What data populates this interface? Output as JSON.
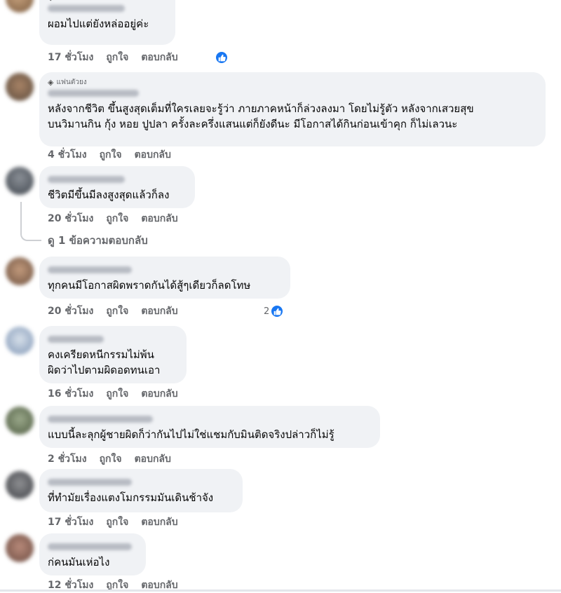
{
  "badge_text": "แฟนตัวยง",
  "actions": {
    "like": "ถูกใจ",
    "reply": "ตอบกลับ"
  },
  "view_replies": "ดู 1 ข้อความตอบกลับ",
  "comments": [
    {
      "text": "ผอมไปแต่ยังหล่ออยู่ค่ะ",
      "time": "17 ชั่วโมง"
    },
    {
      "text": "หลังจากชีวิต ขึ้นสูงสุดเต็มที่ใครเลยจะรู้ว่า ภายภาคหน้าก็ล่วงลงมา โดยไม่รู้ตัว หลังจากเสวยสุข\nบนวิมานกิน กุ้ง หอย ปูปลา ครั้งละครึ่งแสนแต่ก็ยังดีนะ มีโอกาสได้กินก่อนเข้าคุก ก็ไม่เลวนะ",
      "time": "4 ชั่วโมง"
    },
    {
      "text": "ชีวิตมีขึ้นมีลงสูงสุดแล้วก็ลง",
      "time": "20 ชั่วโมง"
    },
    {
      "text": "ทุกคนมีโอกาสผิดพราดกันได้สู้ๆเดียวก็ลดโทษ",
      "time": "20 ชั่วโมง",
      "reactions": "2"
    },
    {
      "text": "คงเครียดหนีกรรมไม่พ้น\nผิดว่าไปตามผิดอดทนเอา",
      "time": "16 ชั่วโมง"
    },
    {
      "text": "แบบนี้ละลุกผู้ชายผิดก็ว่ากันไปไม่ใช่แชมกับมินติดจริงปล่าวก็ไม่รู้",
      "time": "2 ชั่วโมง"
    },
    {
      "text": "ที่ทำมัยเรื่องแตงโมกรรมมันเดินช้าจัง",
      "time": "17 ชั่วโมง"
    },
    {
      "text": "ก่คนมันเห่อไง",
      "time": "12 ชั่วโมง"
    }
  ],
  "colors": {
    "like_blue": "#1877f2",
    "bubble_bg": "#f0f2f5",
    "meta_gray": "#65676b"
  }
}
